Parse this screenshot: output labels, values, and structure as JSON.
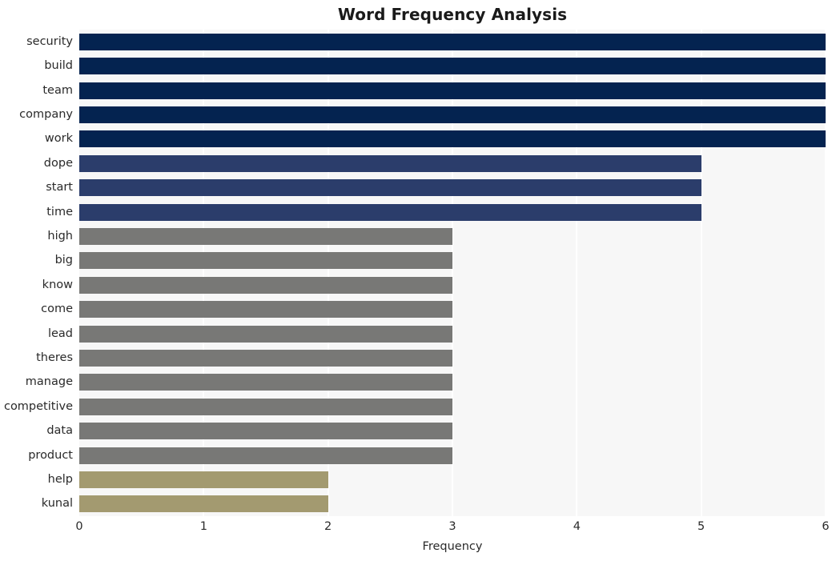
{
  "chart_data": {
    "type": "bar",
    "orientation": "horizontal",
    "title": "Word Frequency Analysis",
    "xlabel": "Frequency",
    "ylabel": "",
    "xlim": [
      0,
      6.0
    ],
    "xticks": [
      "0",
      "1",
      "2",
      "3",
      "4",
      "5",
      "6"
    ],
    "xtick_values": [
      0,
      1,
      2,
      3,
      4,
      5,
      6
    ],
    "grid": "vertical-white-on-light-gray",
    "legend": "none",
    "categories": [
      "security",
      "build",
      "team",
      "company",
      "work",
      "dope",
      "start",
      "time",
      "high",
      "big",
      "know",
      "come",
      "lead",
      "theres",
      "manage",
      "competitive",
      "data",
      "product",
      "help",
      "kunal"
    ],
    "values": [
      6,
      6,
      6,
      6,
      6,
      5,
      5,
      5,
      3,
      3,
      3,
      3,
      3,
      3,
      3,
      3,
      3,
      3,
      2,
      2
    ],
    "bar_colors": [
      "#042350",
      "#042350",
      "#042350",
      "#042350",
      "#042350",
      "#2b3d6b",
      "#2b3d6b",
      "#2b3d6b",
      "#787876",
      "#787876",
      "#787876",
      "#787876",
      "#787876",
      "#787876",
      "#787876",
      "#787876",
      "#787876",
      "#787876",
      "#a39a70",
      "#a39a70"
    ]
  },
  "colors": {
    "page_background": "#ffffff",
    "plot_background": "#f7f7f7",
    "gridline": "#ffffff",
    "text": "#2a2a2a",
    "title_text": "#1a1a1a",
    "value_6": "#042350",
    "value_5": "#2b3d6b",
    "value_3": "#787876",
    "value_2": "#a39a70"
  }
}
